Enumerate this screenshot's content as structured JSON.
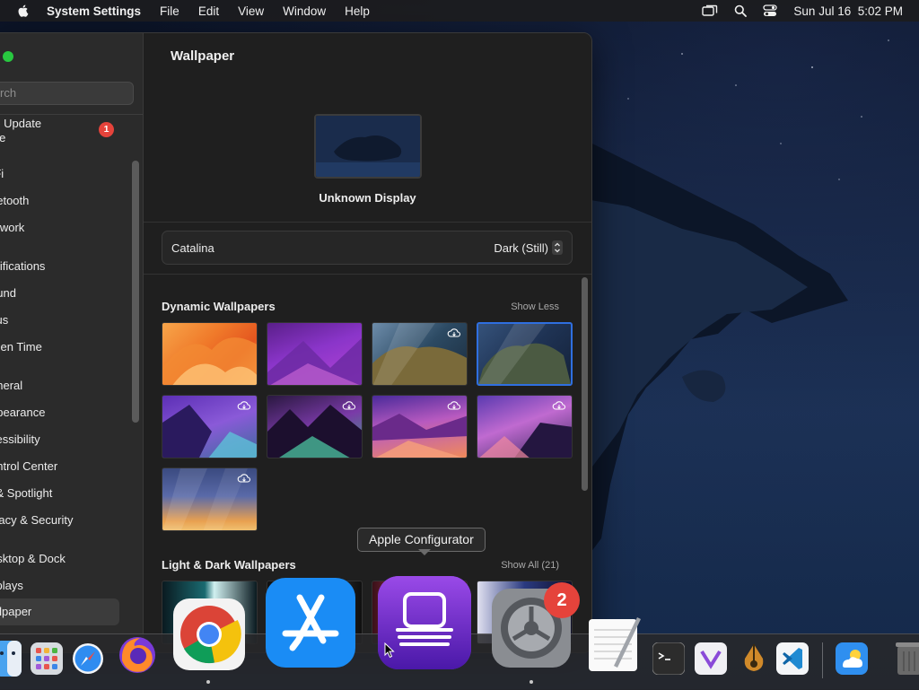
{
  "menubar": {
    "app_name": "System Settings",
    "menus": [
      "File",
      "Edit",
      "View",
      "Window",
      "Help"
    ],
    "clock": "Sun Jul 16  5:02 PM",
    "status_icons": [
      "screen-mirroring-icon",
      "spotlight-search-icon",
      "control-center-icon"
    ]
  },
  "sidebar": {
    "search_placeholder": "rch",
    "software_update": {
      "line1": "re Update",
      "line2": "ole",
      "badge": "1"
    },
    "items": [
      "-Fi",
      "uetooth",
      "etwork",
      "otifications",
      "ound",
      "cus",
      "reen Time",
      "eneral",
      "ppearance",
      "cessibility",
      "ontrol Center",
      "i & Spotlight",
      "ivacy & Security",
      "esktop & Dock",
      "splays",
      "allpaper"
    ],
    "selected": "allpaper"
  },
  "main": {
    "title": "Wallpaper",
    "display_name": "Unknown Display",
    "wallpaper_name": "Catalina",
    "wallpaper_mode": "Dark (Still)",
    "dynamic_title": "Dynamic Wallpapers",
    "dynamic_link": "Show Less",
    "light_dark_title": "Light & Dark Wallpapers",
    "light_dark_link": "Show All (21)",
    "dynamic_thumbnails": [
      {
        "name": "ventura-orange",
        "cloud": false,
        "selected": false
      },
      {
        "name": "monterey-purple",
        "cloud": false,
        "selected": false
      },
      {
        "name": "catalina-split",
        "cloud": true,
        "selected": false
      },
      {
        "name": "catalina-island",
        "cloud": false,
        "selected": true
      },
      {
        "name": "big-sur-coast-purple",
        "cloud": true,
        "selected": false
      },
      {
        "name": "big-sur-lake",
        "cloud": true,
        "selected": false
      },
      {
        "name": "big-sur-mountains",
        "cloud": true,
        "selected": false
      },
      {
        "name": "big-sur-beach",
        "cloud": true,
        "selected": false
      },
      {
        "name": "blue-gradient",
        "cloud": true,
        "selected": false
      }
    ]
  },
  "tooltip": "Apple Configurator",
  "dock": {
    "apps": [
      "Finder",
      "Launchpad",
      "Safari",
      "Firefox",
      "Google Chrome",
      "App Store",
      "Apple Configurator",
      "System Settings",
      "TextEdit",
      "Terminal",
      "Visual Studio",
      "Xcode Instruments",
      "Visual Studio Code",
      "Weather",
      "Trash"
    ],
    "settings_badge": "2"
  }
}
